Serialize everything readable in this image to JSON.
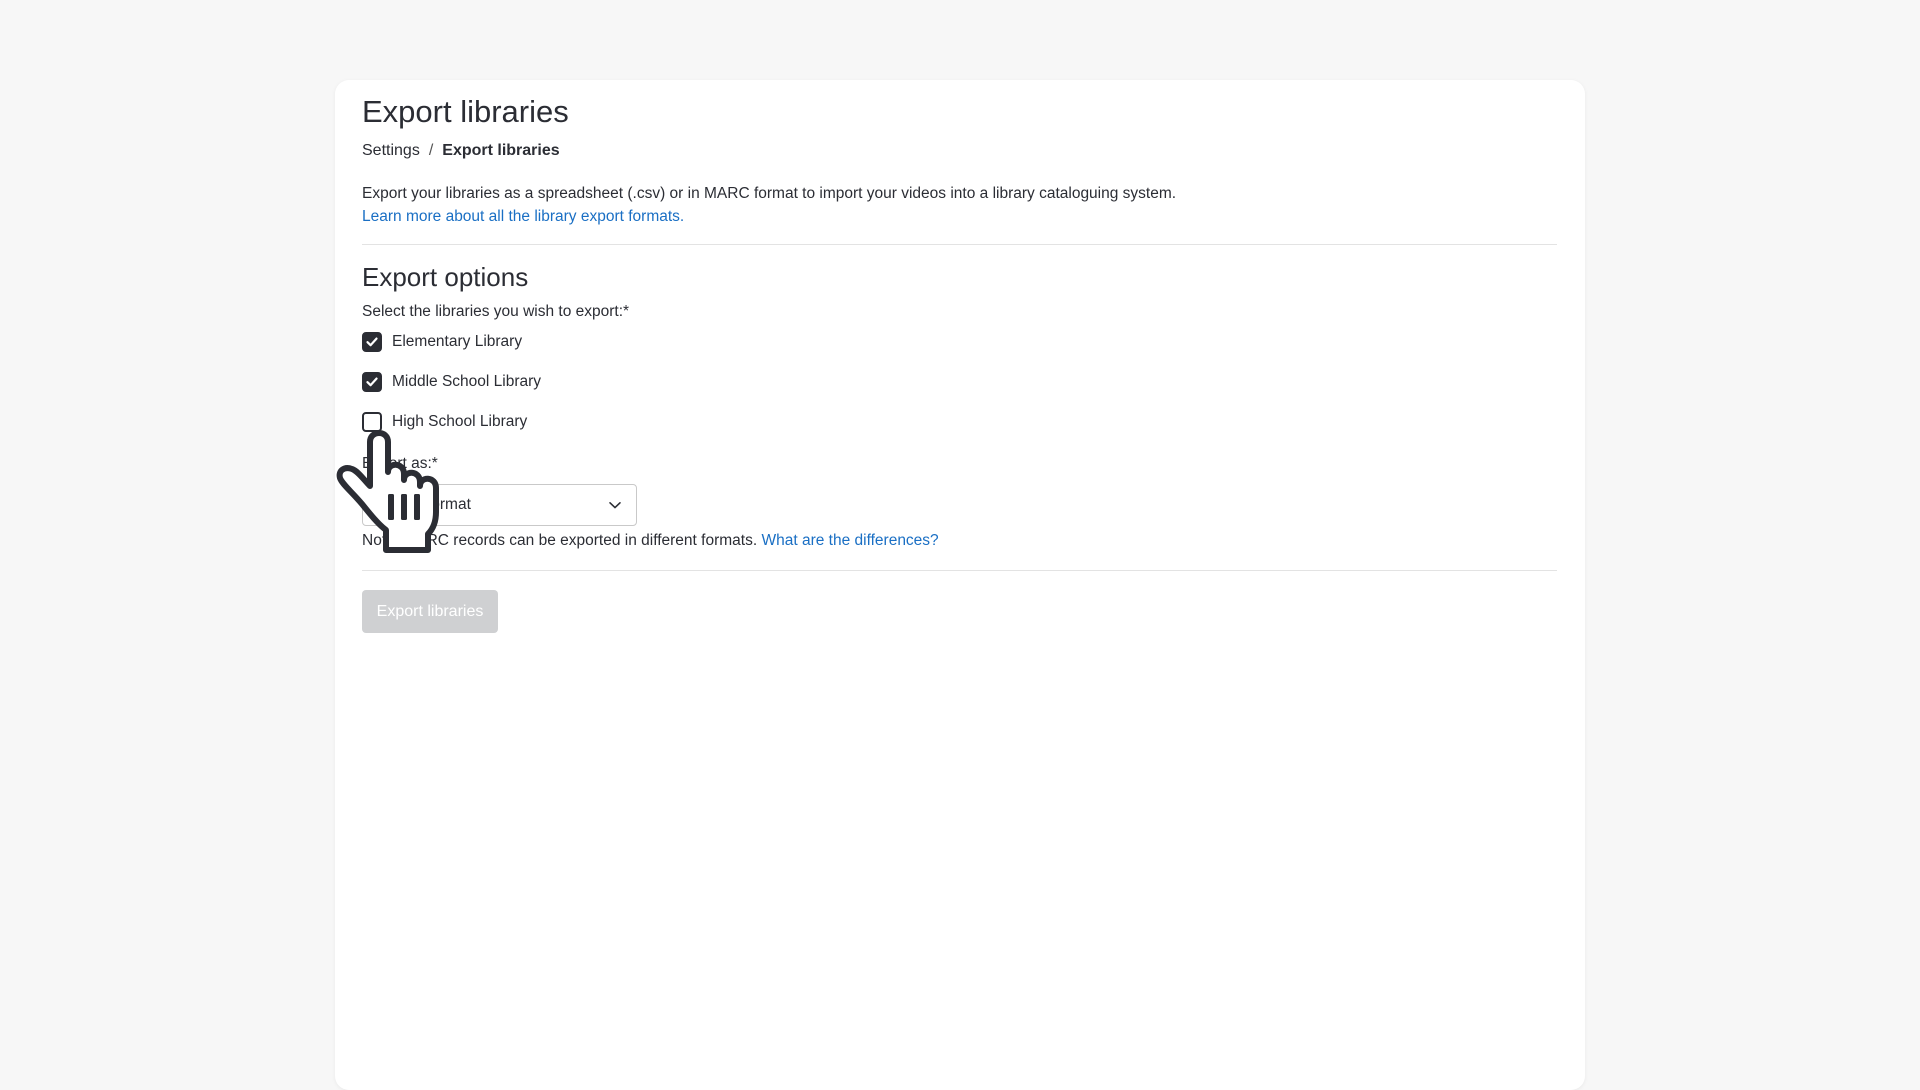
{
  "header": {
    "title": "Export libraries",
    "breadcrumb": {
      "parent": "Settings",
      "separator": "/",
      "current": "Export libraries"
    }
  },
  "intro": {
    "description": "Export your libraries as a spreadsheet (.csv) or in MARC format to import your videos into a library cataloguing system.",
    "learn_more_link": "Learn more about all the library export formats."
  },
  "export_options": {
    "title": "Export options",
    "libraries_label": "Select the libraries you wish to export:*",
    "libraries": [
      {
        "label": "Elementary Library",
        "checked": true
      },
      {
        "label": "Middle School Library",
        "checked": true
      },
      {
        "label": "High School Library",
        "checked": false
      }
    ],
    "export_as_label": "Export as:*",
    "format_select": {
      "selected": "MARC format",
      "icon": "chevron-down-icon"
    },
    "help_text": "Note: MARC records can be exported in different formats.",
    "help_link": "What are the differences?"
  },
  "actions": {
    "export_button": "Export libraries",
    "export_button_disabled": true
  },
  "cursor": {
    "icon": "hand-pointer-icon"
  },
  "colors": {
    "page_background": "#f7f7f7",
    "card_background": "#ffffff",
    "text": "#2b2d34",
    "link": "#1a6fc4",
    "button_disabled": "#cfd0d2",
    "checkbox_checked": "#2b2d34"
  }
}
